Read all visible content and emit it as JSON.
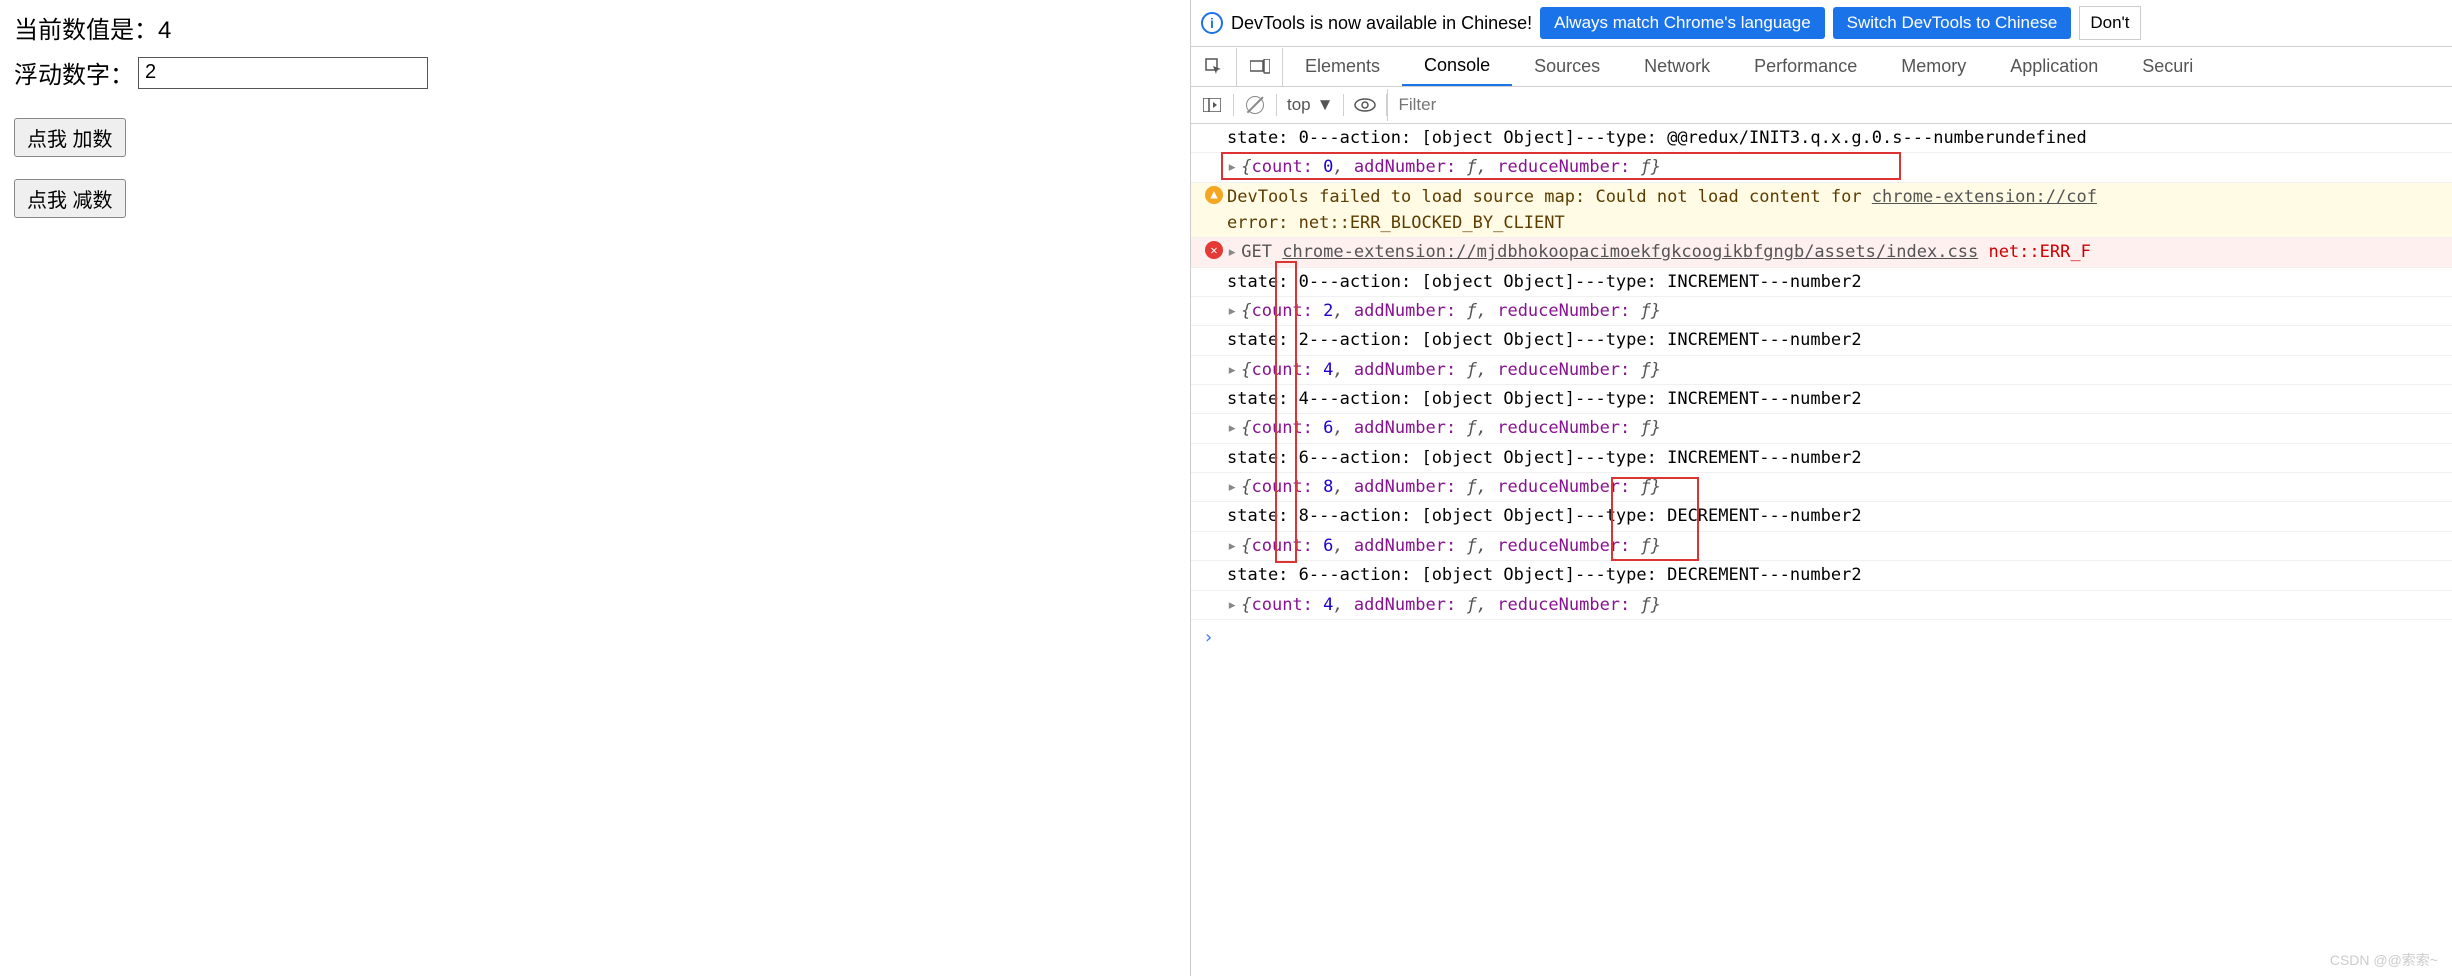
{
  "left": {
    "current_prefix": "当前数值是：",
    "current_value": "4",
    "float_label": "浮动数字：",
    "float_value": "2",
    "add_btn": "点我 加数",
    "reduce_btn": "点我 减数"
  },
  "infobar": {
    "text": "DevTools is now available in Chinese!",
    "match_btn": "Always match Chrome's language",
    "switch_btn": "Switch DevTools to Chinese",
    "dont_btn": "Don't"
  },
  "tabs": {
    "elements": "Elements",
    "console": "Console",
    "sources": "Sources",
    "network": "Network",
    "performance": "Performance",
    "memory": "Memory",
    "application": "Application",
    "security": "Securi"
  },
  "filter": {
    "context": "top",
    "placeholder": "Filter"
  },
  "logs": {
    "r0": "state: 0---action: [object Object]---type: @@redux/INIT3.q.x.g.0.s---numberundefined",
    "obj0": {
      "count": "0"
    },
    "warn_l1": "DevTools failed to load source map: Could not load content for ",
    "warn_link": "chrome-extension://cof",
    "warn_l2": "error: net::ERR_BLOCKED_BY_CLIENT",
    "err_method": "GET",
    "err_url": "chrome-extension://mjdbhokoopacimoekfgkcoogikbfgngb/assets/index.css",
    "err_tail": "net::ERR_F",
    "r1": "state: 0---action: [object Object]---type: INCREMENT---number2",
    "obj1": {
      "count": "2"
    },
    "r2": "state: 2---action: [object Object]---type: INCREMENT---number2",
    "obj2": {
      "count": "4"
    },
    "r3": "state: 4---action: [object Object]---type: INCREMENT---number2",
    "obj3": {
      "count": "6"
    },
    "r4": "state: 6---action: [object Object]---type: INCREMENT---number2",
    "obj4": {
      "count": "8"
    },
    "r5": "state: 8---action: [object Object]---type: DECREMENT---number2",
    "obj5": {
      "count": "6"
    },
    "r6": "state: 6---action: [object Object]---type: DECREMENT---number2",
    "obj6": {
      "count": "4"
    },
    "obj_common": {
      "add": "addNumber: ",
      "reduce": "reduceNumber: ",
      "fn": "ƒ",
      "countk": "count: "
    }
  },
  "watermark": "CSDN @@索索~"
}
